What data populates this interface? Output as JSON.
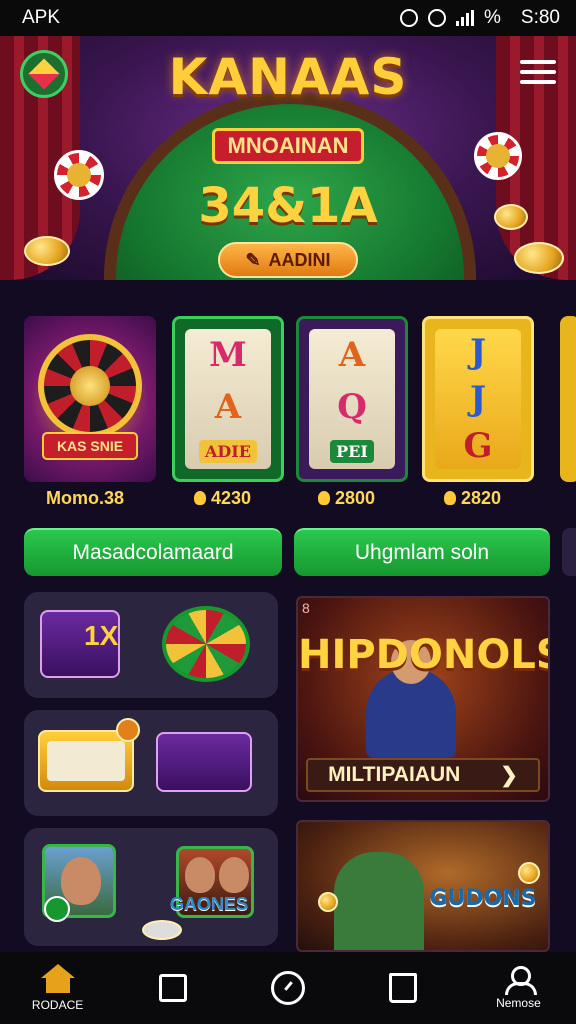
{
  "status_bar": {
    "carrier": "APK",
    "battery": "%",
    "time": "S:80"
  },
  "banner": {
    "title": "KANAAS",
    "ribbon": "MNOAINAN",
    "jackpot": "34&1A",
    "button_label": "AADINI"
  },
  "games": [
    {
      "label": "KAS SNIE",
      "value": "Momo.38",
      "icon": "wheel-icon"
    },
    {
      "symbols": [
        "M",
        "A",
        "ADIE"
      ],
      "value": "4230"
    },
    {
      "symbols": [
        "A",
        "Q",
        "PEI"
      ],
      "value": "2800"
    },
    {
      "symbols": [
        "J",
        "J",
        "G"
      ],
      "value": "2820"
    }
  ],
  "buttons": {
    "left": "Masadcolamaard",
    "right": "Uhgmlam soln"
  },
  "promos": [
    {
      "title": "HIPDONOLS",
      "button": "MILTIPAIAUN"
    },
    {
      "title": "GUDONS"
    }
  ],
  "tiles": [
    {
      "left_text": "1X",
      "icon": "slot-icon"
    },
    {
      "left_text": "",
      "icon": "reel-icon"
    },
    {
      "right_text": "GAONES"
    }
  ],
  "nav": {
    "items": [
      {
        "label": "RODACE",
        "icon": "home-icon"
      },
      {
        "label": "",
        "icon": "message-icon"
      },
      {
        "label": "",
        "icon": "clock-icon"
      },
      {
        "label": "",
        "icon": "bag-icon"
      },
      {
        "label": "Nemose",
        "icon": "profile-icon"
      }
    ]
  },
  "colors": {
    "accent_green": "#2bc84e",
    "gold": "#ffd23f",
    "background": "#120b22"
  }
}
